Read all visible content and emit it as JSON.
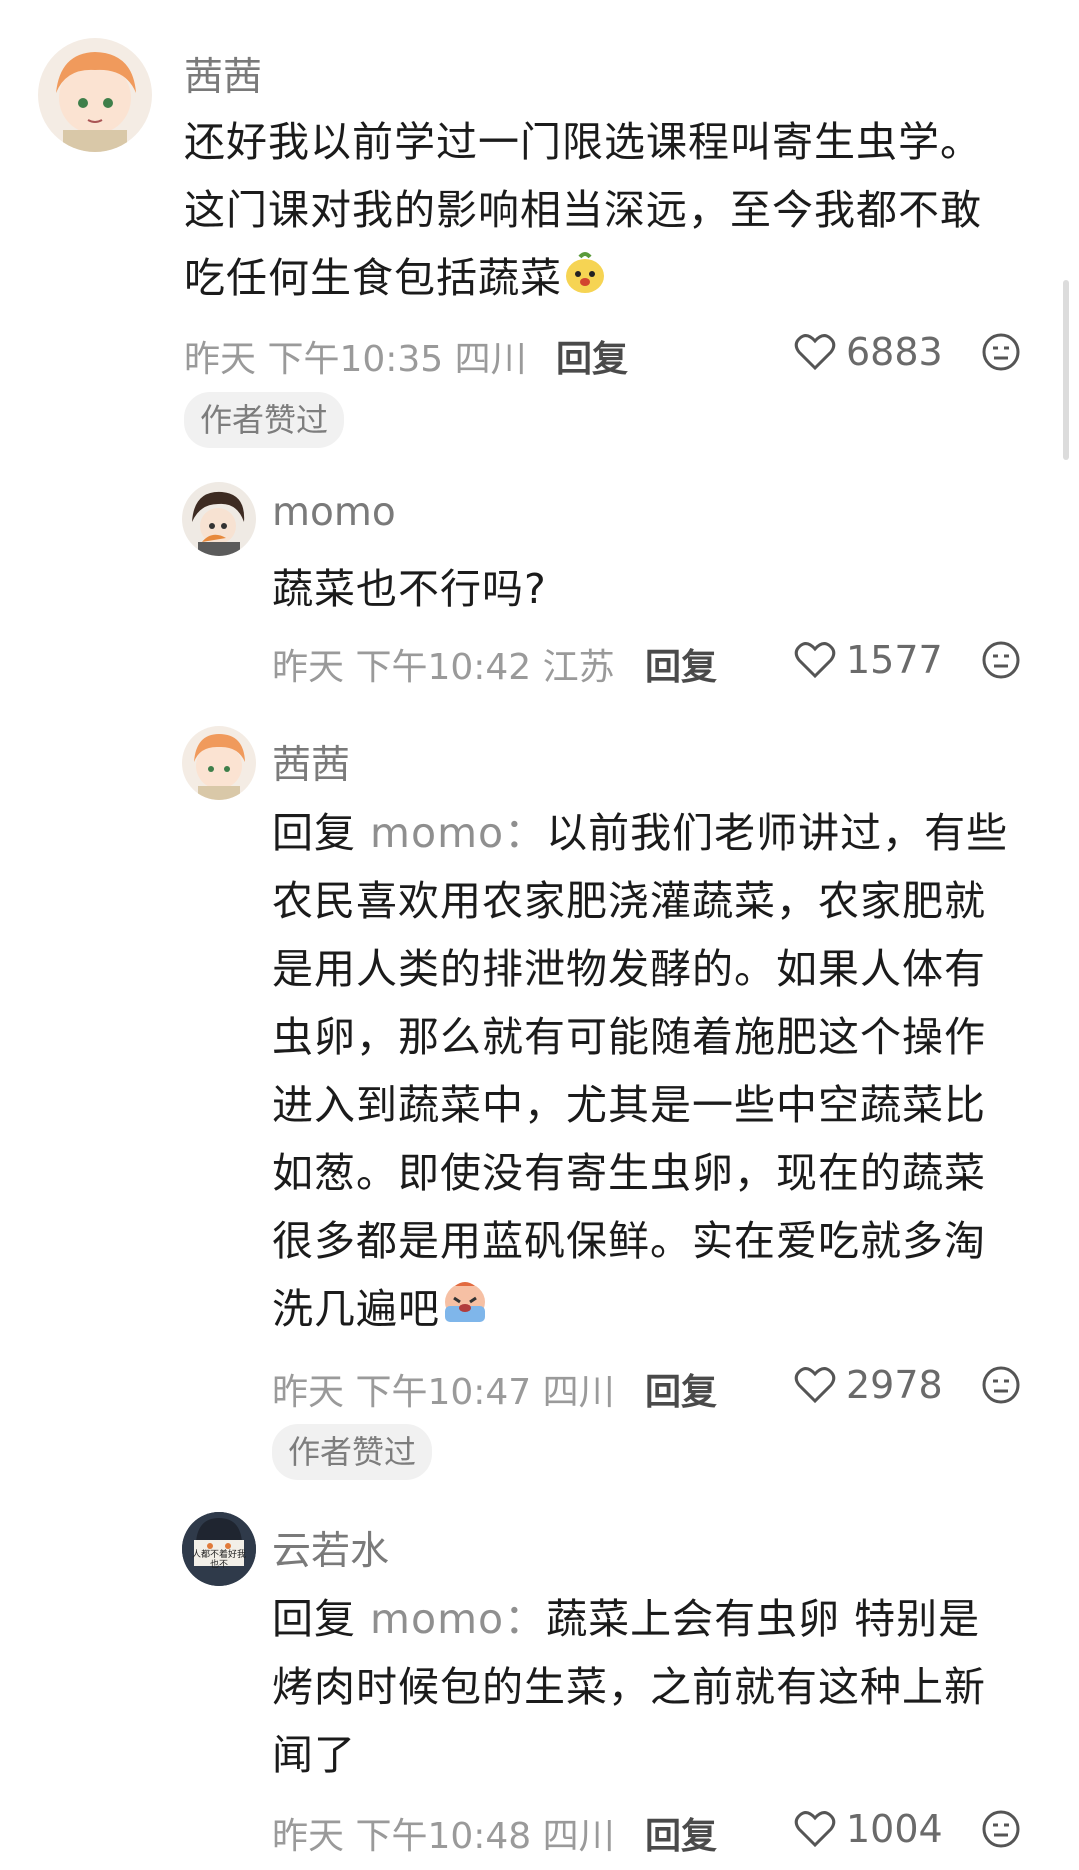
{
  "comments": [
    {
      "user": "茜茜",
      "text": "还好我以前学过一门限选课程叫寄生虫学。这门课对我的影响相当深远，至今我都不敢吃任何生食包括蔬菜",
      "lines": [
        "还好我以前学过一门限选课程叫寄生虫学。",
        "这门课对我的影响相当深远，至今我都不敢",
        "吃任何生食包括蔬菜"
      ],
      "emoji": "mango-face-emoji",
      "time": "昨天 下午10:35 四川",
      "reply_label": "回复",
      "likes": "6883",
      "badge": "作者赞过"
    },
    {
      "user": "momo",
      "text": "蔬菜也不行吗?",
      "time": "昨天 下午10:42 江苏",
      "reply_label": "回复",
      "likes": "1577"
    },
    {
      "user": "茜茜",
      "reply_prefix": "回复",
      "reply_target": "momo：",
      "lines": [
        "以前我们老师讲过，有些",
        "农民喜欢用农家肥浇灌蔬菜，农家肥就",
        "是用人类的排泄物发酵的。如果人体有",
        "虫卵，那么就有可能随着施肥这个操作",
        "进入到蔬菜中，尤其是一些中空蔬菜比",
        "如葱。即使没有寄生虫卵，现在的蔬菜",
        "很多都是用蓝矾保鲜。实在爱吃就多淘",
        "洗几遍吧"
      ],
      "emoji": "crying-face-emoji",
      "time": "昨天 下午10:47 四川",
      "reply_label": "回复",
      "likes": "2978",
      "badge": "作者赞过"
    },
    {
      "user": "云若水",
      "avatar_text": "人都不着好我也不",
      "reply_prefix": "回复",
      "reply_target": "momo：",
      "lines": [
        "蔬菜上会有虫卵 特别是",
        "烤肉时候包的生菜，之前就有这种上新",
        "闻了"
      ],
      "time": "昨天 下午10:48 四川",
      "reply_label": "回复",
      "likes": "1004"
    }
  ],
  "colors": {
    "text": "#1b1b1b",
    "meta": "#9a9a9a",
    "badge_bg": "#f1f1f1"
  }
}
